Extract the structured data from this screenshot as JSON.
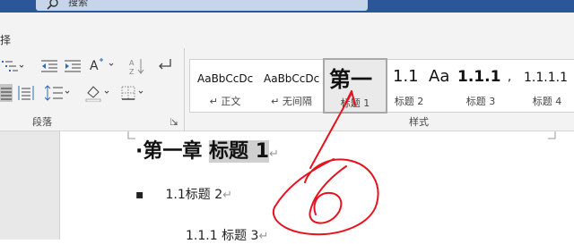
{
  "search": {
    "label": "搜索"
  },
  "ribbon": {
    "cutoff_char": "择",
    "paragraph_group_label": "段落",
    "styles_group_label": "样式"
  },
  "styles": [
    {
      "sample": "AaBbCcDc",
      "name": "↵ 正文"
    },
    {
      "sample": "AaBbCcDc",
      "name": "↵ 无间隔"
    },
    {
      "sample": "第一",
      "name": "标题 1"
    },
    {
      "sample": "1.1",
      "name": "标题 2"
    },
    {
      "sample": "Aa",
      "name": ""
    },
    {
      "sample": "1.1.1",
      "name": "标题 3"
    },
    {
      "sample": ",",
      "name": ""
    },
    {
      "sample": "1.1.1.1",
      "name": "标题 4"
    }
  ],
  "document": {
    "heading1_prefix": "·第一章  ",
    "heading1_highlight": "标题 1",
    "heading2_bullet": "▪",
    "heading2": "1.1标题 2",
    "heading3": "1.1.1  标题 3",
    "para_mark": "↵"
  },
  "annotation": {
    "number": "6",
    "color": "#e8121f"
  }
}
